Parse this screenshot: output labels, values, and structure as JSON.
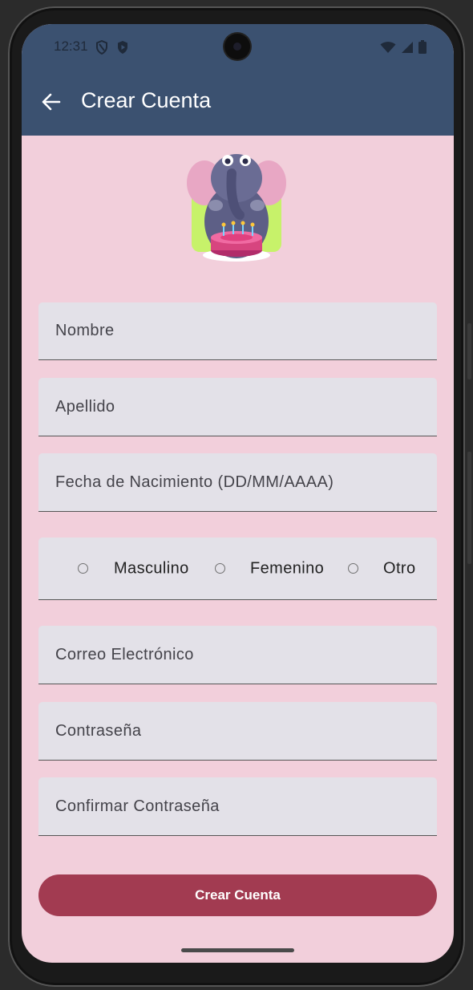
{
  "status_bar": {
    "time": "12:31",
    "left_icons": [
      "shield-icon",
      "play-protect-icon"
    ],
    "right_icons": [
      "wifi-icon",
      "signal-icon",
      "battery-icon"
    ]
  },
  "app_bar": {
    "back_icon": "arrow-back-icon",
    "title": "Crear Cuenta",
    "background": "#3b5170"
  },
  "mascot": {
    "icon": "elephant-birthday-cake-icon"
  },
  "form": {
    "first_name": {
      "placeholder": "Nombre",
      "value": ""
    },
    "last_name": {
      "placeholder": "Apellido",
      "value": ""
    },
    "birth_date": {
      "placeholder": "Fecha de Nacimiento (DD/MM/AAAA)",
      "value": ""
    },
    "gender": {
      "options": [
        {
          "label": "Masculino",
          "selected": false
        },
        {
          "label": "Femenino",
          "selected": false
        },
        {
          "label": "Otro",
          "selected": false
        }
      ]
    },
    "email": {
      "placeholder": "Correo Electrónico",
      "value": ""
    },
    "password": {
      "placeholder": "Contraseña",
      "value": ""
    },
    "confirm_password": {
      "placeholder": "Confirmar Contraseña",
      "value": ""
    }
  },
  "submit_button": {
    "label": "Crear Cuenta",
    "color": "#a23b51"
  },
  "colors": {
    "page_background": "#f2cfdb",
    "field_background": "#e3e1e8"
  }
}
